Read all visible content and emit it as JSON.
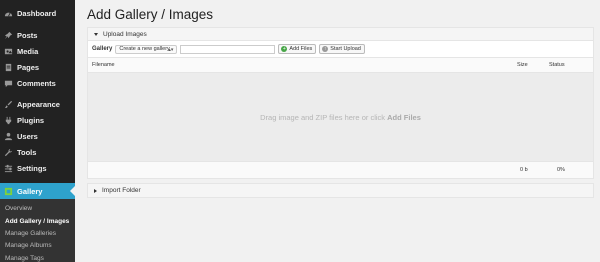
{
  "sidebar": {
    "items": [
      {
        "label": "Dashboard",
        "icon": "dashboard-icon"
      },
      {
        "label": "Posts",
        "icon": "pin-icon"
      },
      {
        "label": "Media",
        "icon": "media-icon"
      },
      {
        "label": "Pages",
        "icon": "pages-icon"
      },
      {
        "label": "Comments",
        "icon": "comment-icon"
      },
      {
        "label": "Appearance",
        "icon": "brush-icon"
      },
      {
        "label": "Plugins",
        "icon": "plug-icon"
      },
      {
        "label": "Users",
        "icon": "user-icon"
      },
      {
        "label": "Tools",
        "icon": "wrench-icon"
      },
      {
        "label": "Settings",
        "icon": "settings-icon"
      },
      {
        "label": "Gallery",
        "icon": "gallery-icon",
        "active": true
      }
    ],
    "submenu": [
      {
        "label": "Overview"
      },
      {
        "label": "Add Gallery / Images",
        "current": true
      },
      {
        "label": "Manage Galleries"
      },
      {
        "label": "Manage Albums"
      },
      {
        "label": "Manage Tags"
      }
    ]
  },
  "main": {
    "title": "Add Gallery / Images",
    "upload_panel": {
      "title": "Upload Images",
      "gallery_label": "Gallery",
      "select_value": "Create a new gallery",
      "input_value": "",
      "add_files_label": "Add Files",
      "start_upload_label": "Start Upload",
      "columns": {
        "filename": "Filename",
        "size": "Size",
        "status": "Status"
      },
      "drop_message": "Drag image and ZIP files here or click",
      "drop_link": "Add Files",
      "total_size": "0 b",
      "total_status": "0%"
    },
    "import_panel": {
      "title": "Import Folder"
    }
  },
  "colors": {
    "sidebar_bg": "#222222",
    "active_accent": "#2ea2cc",
    "page_bg": "#f1f1f1"
  }
}
